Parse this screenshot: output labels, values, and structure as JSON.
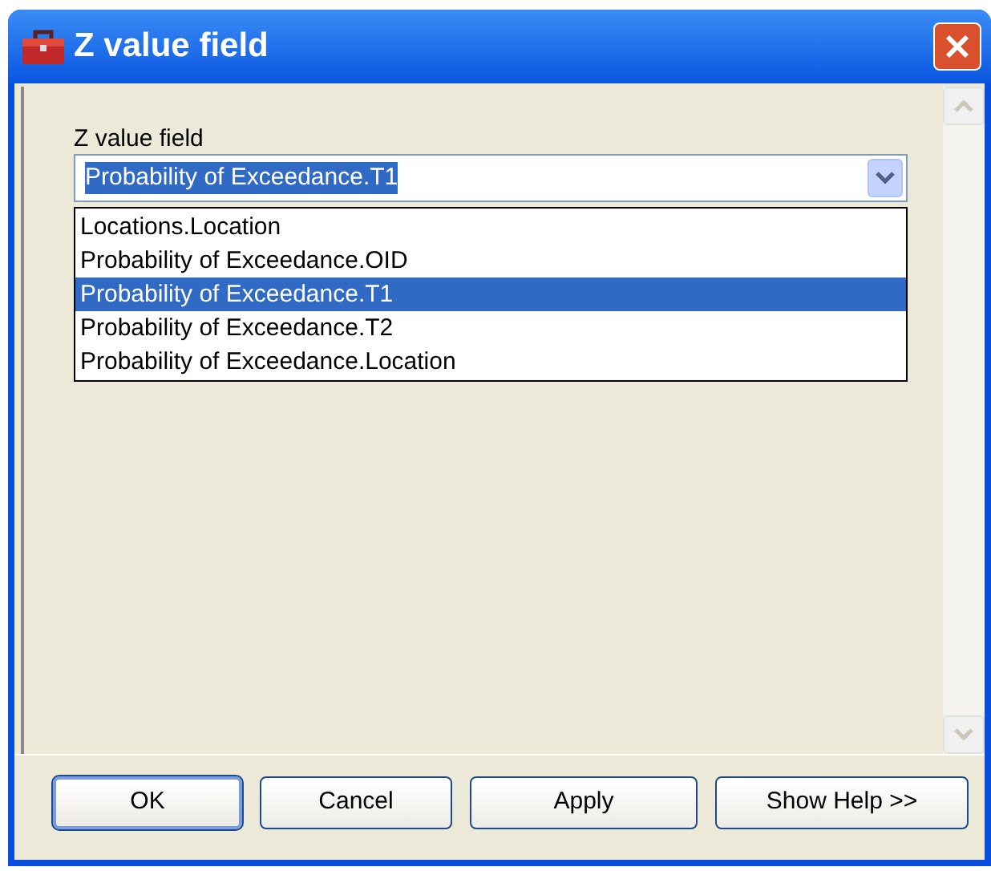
{
  "window": {
    "title": "Z value field"
  },
  "field": {
    "label": "Z value field",
    "value": "Probability of Exceedance.T1",
    "value_highlighted": true,
    "expanded": true
  },
  "options": [
    {
      "label": "Locations.Location",
      "selected": false
    },
    {
      "label": "Probability of Exceedance.OID",
      "selected": false
    },
    {
      "label": "Probability of Exceedance.T1",
      "selected": true
    },
    {
      "label": "Probability of Exceedance.T2",
      "selected": false
    },
    {
      "label": "Probability of Exceedance.Location",
      "selected": false
    }
  ],
  "buttons": [
    {
      "label": "OK",
      "default": true
    },
    {
      "label": "Cancel",
      "default": false
    },
    {
      "label": "Apply",
      "default": false
    },
    {
      "label": "Show Help >>",
      "default": false
    }
  ]
}
